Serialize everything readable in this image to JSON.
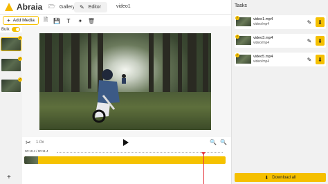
{
  "app": {
    "name": "Abraia"
  },
  "nav": {
    "gallery_label": "Gallery",
    "editor_label": "Editor",
    "project_name": "video1"
  },
  "toolbar": {
    "add_media_label": "Add Media",
    "icons": [
      "new-file-icon",
      "save-icon",
      "text-icon",
      "magic-icon",
      "delete-icon"
    ]
  },
  "sidebar": {
    "bulk_label": "Bulk",
    "bulk_enabled": true,
    "items": [
      {
        "selected": true,
        "checked": true
      },
      {
        "selected": false,
        "checked": true
      },
      {
        "selected": false,
        "checked": true
      }
    ]
  },
  "player": {
    "speed_label": "1.0x"
  },
  "timeline": {
    "time_label": "00:10.4 / 00:11.4"
  },
  "tasks": {
    "title": "Tasks",
    "items": [
      {
        "name": "video1.mp4",
        "subtitle": "video/mp4"
      },
      {
        "name": "video3.mp4",
        "subtitle": "video/mp4"
      },
      {
        "name": "video5.mp4",
        "subtitle": "video/mp4"
      }
    ],
    "download_all_label": "Download all"
  },
  "colors": {
    "accent": "#f5c000",
    "playhead": "#e5333b"
  }
}
